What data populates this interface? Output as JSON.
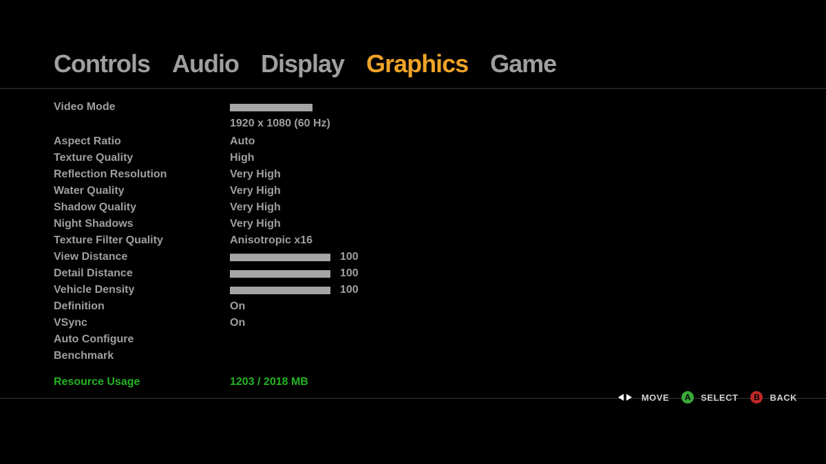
{
  "tabs": {
    "controls": "Controls",
    "audio": "Audio",
    "display": "Display",
    "graphics": "Graphics",
    "game": "Game"
  },
  "settings": {
    "video_mode_label": "Video Mode",
    "video_mode_value": "1920 x 1080 (60 Hz)",
    "aspect_ratio_label": "Aspect Ratio",
    "aspect_ratio_value": "Auto",
    "texture_quality_label": "Texture Quality",
    "texture_quality_value": "High",
    "reflection_res_label": "Reflection Resolution",
    "reflection_res_value": "Very High",
    "water_quality_label": "Water Quality",
    "water_quality_value": "Very High",
    "shadow_quality_label": "Shadow Quality",
    "shadow_quality_value": "Very High",
    "night_shadows_label": "Night Shadows",
    "night_shadows_value": "Very High",
    "texture_filter_label": "Texture Filter Quality",
    "texture_filter_value": "Anisotropic x16",
    "view_distance_label": "View Distance",
    "view_distance_value": "100",
    "detail_distance_label": "Detail Distance",
    "detail_distance_value": "100",
    "vehicle_density_label": "Vehicle Density",
    "vehicle_density_value": "100",
    "definition_label": "Definition",
    "definition_value": "On",
    "vsync_label": "VSync",
    "vsync_value": "On",
    "auto_configure_label": "Auto Configure",
    "benchmark_label": "Benchmark",
    "resource_usage_label": "Resource Usage",
    "resource_usage_value": "1203 / 2018 MB"
  },
  "footer": {
    "move": "MOVE",
    "select": "SELECT",
    "back": "BACK",
    "a": "A",
    "b": "B"
  }
}
